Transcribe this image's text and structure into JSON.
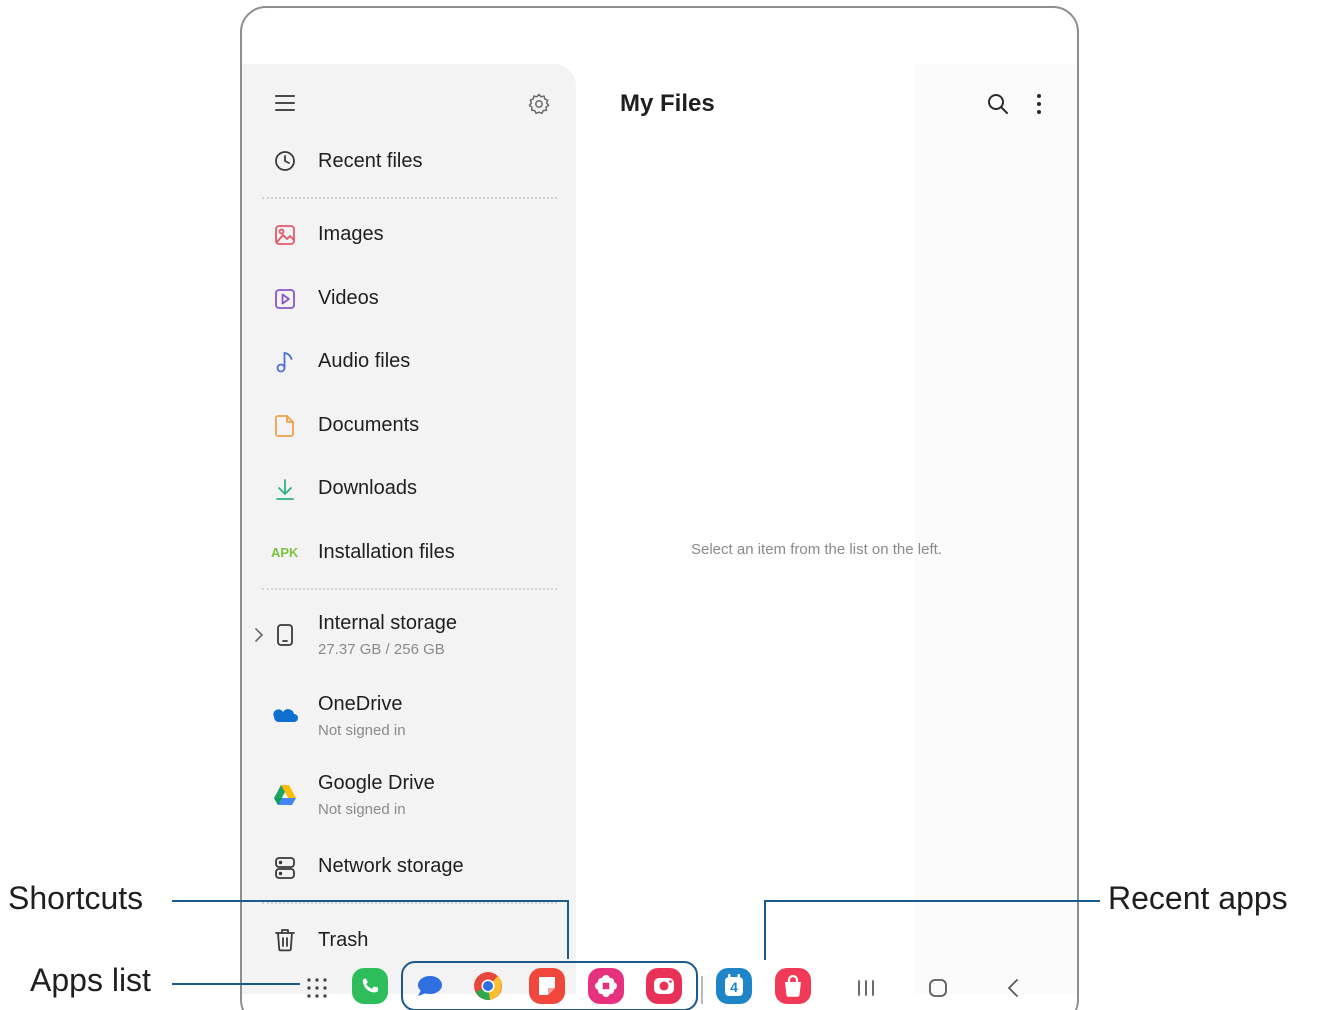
{
  "header": {
    "title": "My Files",
    "icons": [
      "menu-icon",
      "settings-icon",
      "search-icon",
      "more-options-icon"
    ]
  },
  "sidebar": {
    "recent": {
      "label": "Recent files"
    },
    "categories": [
      {
        "label": "Images",
        "icon": "images-icon",
        "color": "#e35a6c"
      },
      {
        "label": "Videos",
        "icon": "videos-icon",
        "color": "#8a55c9"
      },
      {
        "label": "Audio files",
        "icon": "audio-icon",
        "color": "#4a6fd8"
      },
      {
        "label": "Documents",
        "icon": "documents-icon",
        "color": "#f0a04b"
      },
      {
        "label": "Downloads",
        "icon": "downloads-icon",
        "color": "#2fb187"
      },
      {
        "label": "Installation files",
        "icon_text": "APK",
        "color": "#7bc242"
      }
    ],
    "storage": [
      {
        "label": "Internal storage",
        "sub": "27.37 GB / 256 GB",
        "icon": "phone-icon"
      },
      {
        "label": "OneDrive",
        "sub": "Not signed in",
        "icon": "onedrive-icon"
      },
      {
        "label": "Google Drive",
        "sub": "Not signed in",
        "icon": "google-drive-icon"
      },
      {
        "label": "Network storage",
        "icon": "network-storage-icon"
      }
    ],
    "trash": {
      "label": "Trash"
    }
  },
  "main": {
    "empty_message": "Select an item from the list on the left."
  },
  "taskbar": {
    "pinned": [
      {
        "name": "phone-app-icon",
        "color": "#2dbd5a"
      }
    ],
    "shortcuts": [
      {
        "name": "messages-app-icon",
        "color": "#2f6fe0"
      },
      {
        "name": "chrome-app-icon",
        "color": "#e5473b"
      },
      {
        "name": "samsung-notes-app-icon",
        "color": "#f0463b"
      },
      {
        "name": "gallery-app-icon",
        "color": "#e6317f"
      },
      {
        "name": "camera-app-icon",
        "color": "#e93157"
      }
    ],
    "recent": [
      {
        "name": "calendar-app-icon",
        "color": "#1e86c8",
        "text": "4"
      },
      {
        "name": "galaxy-store-app-icon",
        "color": "#f13a58"
      }
    ],
    "nav": [
      "recents-button",
      "home-button",
      "back-button"
    ]
  },
  "callouts": {
    "shortcuts": "Shortcuts",
    "apps_list": "Apps list",
    "recent_apps": "Recent apps"
  },
  "colors": {
    "accent": "#1b5a8a",
    "frame": "#8e8e8e",
    "sidebar_bg": "#f3f3f3"
  }
}
